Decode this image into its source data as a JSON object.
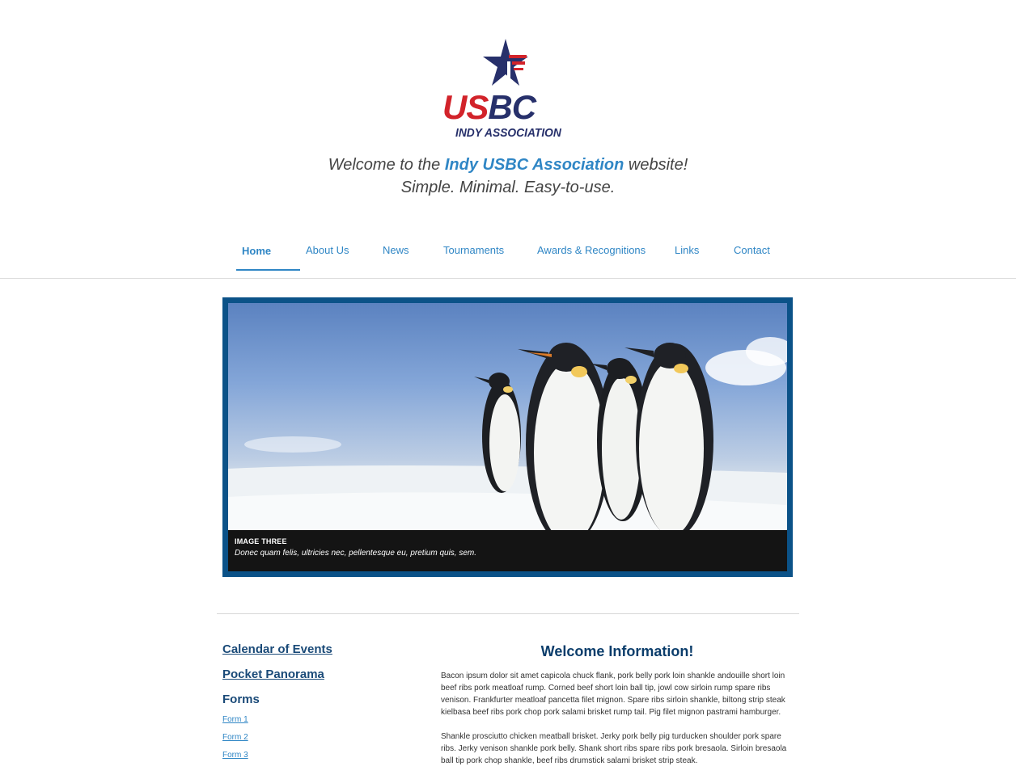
{
  "logo": {
    "usbc_left": "US",
    "usbc_right": "BC",
    "association": "INDY ASSOCIATION",
    "colors": {
      "red": "#d2232a",
      "navy": "#27306b"
    }
  },
  "tagline": {
    "prefix": "Welcome to the ",
    "highlight": "Indy USBC Association",
    "suffix": " website!",
    "line2": "Simple. Minimal. Easy-to-use."
  },
  "nav": {
    "items": [
      {
        "label": "Home",
        "active": true
      },
      {
        "label": "About Us"
      },
      {
        "label": "News"
      },
      {
        "label": "Tournaments"
      },
      {
        "label": "Awards & Recognitions"
      },
      {
        "label": "Links"
      },
      {
        "label": "Contact"
      }
    ],
    "accent_color": "#2f86c5"
  },
  "slider": {
    "caption_title": "IMAGE THREE",
    "caption_text": "Donec quam felis, ultricies nec, pellentesque eu, pretium quis, sem.",
    "frame_color": "#0b5288"
  },
  "sidebar": {
    "calendar_label": "Calendar of Events",
    "panorama_label": "Pocket Panorama",
    "forms_title": "Forms",
    "forms": [
      "Form 1",
      "Form 2",
      "Form 3"
    ]
  },
  "main": {
    "title": "Welcome Information!",
    "paragraphs": [
      "Bacon ipsum dolor sit amet capicola chuck flank, pork belly pork loin shankle andouille short loin beef ribs pork meatloaf rump. Corned beef short loin ball tip, jowl cow sirloin rump spare ribs venison. Frankfurter meatloaf pancetta filet mignon. Spare ribs sirloin shankle, biltong strip steak kielbasa beef ribs pork chop pork salami brisket rump tail. Pig filet mignon pastrami hamburger.",
      "Shankle prosciutto chicken meatball brisket. Jerky pork belly pig turducken shoulder pork spare ribs. Jerky venison shankle pork belly. Shank short ribs spare ribs pork bresaola. Sirloin bresaola ball tip pork chop shankle, beef ribs drumstick salami brisket strip steak."
    ]
  }
}
